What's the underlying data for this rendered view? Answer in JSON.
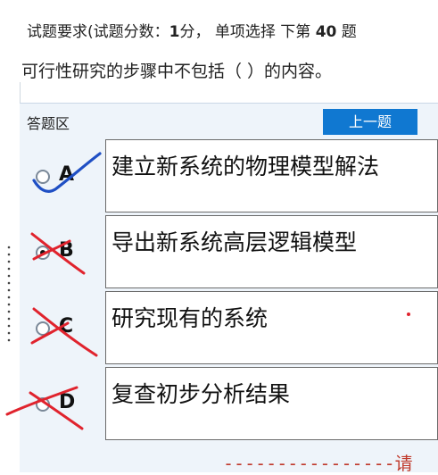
{
  "header": {
    "label": "试题要求(试题分数：",
    "score": "1",
    "score_suffix": "分，  单项选择  下第 ",
    "question_no": "40",
    "question_no_suffix": " 题"
  },
  "question": {
    "text": "可行性研究的步骤中不包括（    ）的内容。"
  },
  "answer_area": {
    "title": "答题区",
    "prev_button_label": "上一题"
  },
  "options": [
    {
      "letter": "A",
      "text": "建立新系统的物理模型解法",
      "selected": false
    },
    {
      "letter": "B",
      "text": "导出新系统高层逻辑模型",
      "selected": true
    },
    {
      "letter": "C",
      "text": "研究现有的系统",
      "selected": false
    },
    {
      "letter": "D",
      "text": "复查初步分析结果",
      "selected": false
    }
  ],
  "footer": {
    "hint": "----------------请"
  },
  "colors": {
    "accent": "#1078d1",
    "mark_red": "#e0232d",
    "mark_blue": "#1f4fc4"
  }
}
